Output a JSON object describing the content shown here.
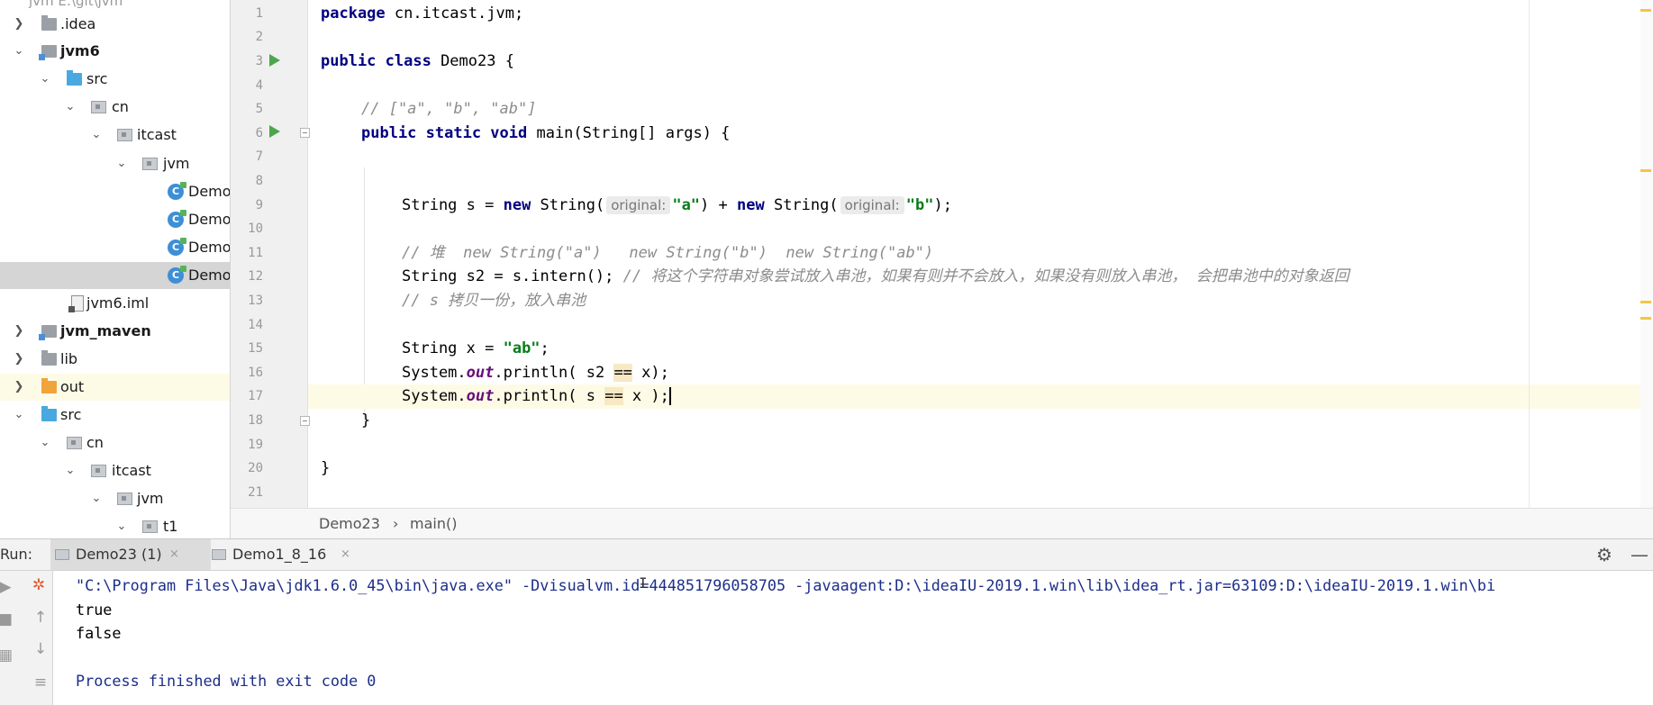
{
  "project_tree": {
    "root_partial": "jvm  E:\\git\\jvm",
    "items": [
      {
        "label": ".idea",
        "kind": "folder"
      },
      {
        "label": "jvm6",
        "kind": "module"
      },
      {
        "label": "src",
        "kind": "source-folder"
      },
      {
        "label": "cn",
        "kind": "package"
      },
      {
        "label": "itcast",
        "kind": "package"
      },
      {
        "label": "jvm",
        "kind": "package"
      },
      {
        "label": "Demo",
        "kind": "class"
      },
      {
        "label": "Demo",
        "kind": "class"
      },
      {
        "label": "Demo",
        "kind": "class"
      },
      {
        "label": "Demo",
        "kind": "class"
      },
      {
        "label": "jvm6.iml",
        "kind": "file"
      },
      {
        "label": "jvm_maven",
        "kind": "module"
      },
      {
        "label": "lib",
        "kind": "folder"
      },
      {
        "label": "out",
        "kind": "output-folder"
      },
      {
        "label": "src",
        "kind": "source-folder"
      },
      {
        "label": "cn",
        "kind": "package"
      },
      {
        "label": "itcast",
        "kind": "package"
      },
      {
        "label": "jvm",
        "kind": "package"
      },
      {
        "label": "t1",
        "kind": "package"
      }
    ],
    "selected_index": 9
  },
  "editor": {
    "line_numbers": [
      "1",
      "2",
      "3",
      "4",
      "5",
      "6",
      "7",
      "8",
      "9",
      "10",
      "11",
      "12",
      "13",
      "14",
      "15",
      "16",
      "17",
      "18",
      "19",
      "20",
      "21"
    ],
    "current_line": 17,
    "code": {
      "l1_kw": "package",
      "l1_rest": " cn.itcast.jvm;",
      "l3_kw": "public class",
      "l3_rest": " Demo23 {",
      "l5_comment": "// [\"a\", \"b\", \"ab\"]",
      "l6_kw": "public static void",
      "l6_rest": " main(String[] args) {",
      "l9_a": "String s = ",
      "l9_new1": "new",
      "l9_b": " String(",
      "l9_hint1": "original:",
      "l9_str1": "\"a\"",
      "l9_c": ") + ",
      "l9_new2": "new",
      "l9_d": " String(",
      "l9_hint2": "original:",
      "l9_str2": "\"b\"",
      "l9_e": ");",
      "l11_comment": "// 堆  new String(\"a\")   new String(\"b\")  new String(\"ab\")",
      "l12_code": "String s2 = s.intern(); ",
      "l12_comment": "// 将这个字符串对象尝试放入串池，如果有则并不会放入，如果没有则放入串池， 会把串池中的对象返回",
      "l13_comment": "// s 拷贝一份，放入串池",
      "l15_a": "String x = ",
      "l15_str": "\"ab\"",
      "l15_b": ";",
      "l16_a": "System.",
      "l16_out": "out",
      "l16_b": ".println( s2 ",
      "l16_eq": "==",
      "l16_c": " x);",
      "l17_a": "System.",
      "l17_out": "out",
      "l17_b": ".println( s ",
      "l17_eq": "==",
      "l17_c": " x );",
      "l18_brace": "}",
      "l20_brace": "}"
    }
  },
  "breadcrumb": {
    "class": "Demo23",
    "separator": "›",
    "method": "main()"
  },
  "run_panel": {
    "title": "Run:",
    "tabs": [
      {
        "label": "Demo23 (1)",
        "close": "×"
      },
      {
        "label": "Demo1_8_16",
        "close": "×"
      }
    ],
    "gear": "⚙",
    "minimize": "—",
    "console": {
      "command": "\"C:\\Program Files\\Java\\jdk1.6.0_45\\bin\\java.exe\" -Dvisualvm.id=444851796058705 -javaagent:D:\\ideaIU-2019.1.win\\lib\\idea_rt.jar=63109:D:\\ideaIU-2019.1.win\\bi",
      "output_1": "true",
      "output_2": "false",
      "exit_message": "Process finished with exit code 0"
    }
  },
  "colors": {
    "keyword": "#000080",
    "string": "#067d17",
    "comment": "#8c8c8c",
    "static_field": "#660e7a",
    "current_line": "#fdfbe6",
    "selected_row": "#d5d5d5",
    "console_system": "#1c2e8a"
  }
}
